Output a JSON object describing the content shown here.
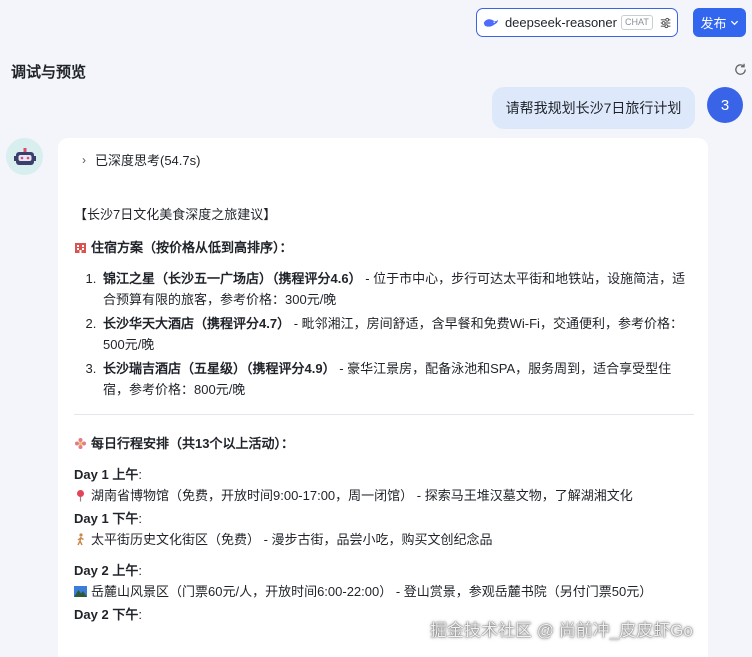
{
  "header": {
    "model_name": "deepseek-reasoner",
    "model_badge": "CHAT",
    "publish_label": "发布"
  },
  "panel": {
    "title": "调试与预览"
  },
  "user_message": {
    "text": "请帮我规划长沙7日旅行计划",
    "avatar_text": "3"
  },
  "answer": {
    "thinking_label": "已深度思考(54.7s)",
    "intro": "【长沙7日文化美食深度之旅建议】",
    "lodging_title": "住宿方案（按价格从低到高排序）：",
    "hotels": [
      {
        "name": "锦江之星（长沙五一广场店）（携程评分4.6）",
        "desc": " - 位于市中心，步行可达太平街和地铁站，设施简洁，适合预算有限的旅客，参考价格：300元/晚"
      },
      {
        "name": "长沙华天大酒店（携程评分4.7）",
        "desc": " - 毗邻湘江，房间舒适，含早餐和免费Wi-Fi，交通便利，参考价格：500元/晚"
      },
      {
        "name": "长沙瑞吉酒店（五星级）（携程评分4.9）",
        "desc": " - 豪华江景房，配备泳池和SPA，服务周到，适合享受型住宿，参考价格：800元/晚"
      }
    ],
    "schedule_title": "每日行程安排（共13个以上活动）：",
    "days": [
      {
        "day": "Day 1",
        "half": " 上午",
        "colon": ":",
        "activity": "湖南省博物馆（免费，开放时间9:00-17:00，周一闭馆） - 探索马王堆汉墓文物，了解湖湘文化",
        "icon": "pin-icon"
      },
      {
        "day": "Day 1",
        "half": " 下午",
        "colon": ":",
        "activity": "太平街历史文化街区（免费） - 漫步古街，品尝小吃，购买文创纪念品",
        "icon": "walker-icon"
      },
      {
        "day": "Day 2",
        "half": " 上午",
        "colon": ":",
        "activity": "岳麓山风景区（门票60元/人，开放时间6:00-22:00） - 登山赏景，参观岳麓书院（另付门票50元）",
        "icon": "mountain-icon"
      },
      {
        "day": "Day 2",
        "half": " 下午",
        "colon": ":",
        "activity": "",
        "icon": ""
      }
    ]
  },
  "watermark": "掘金技术社区 @ 尚前冲_皮皮虾Go",
  "colors": {
    "accent": "#3366ee",
    "user_bubble": "#dde8fb",
    "background": "#f3f5fa"
  }
}
